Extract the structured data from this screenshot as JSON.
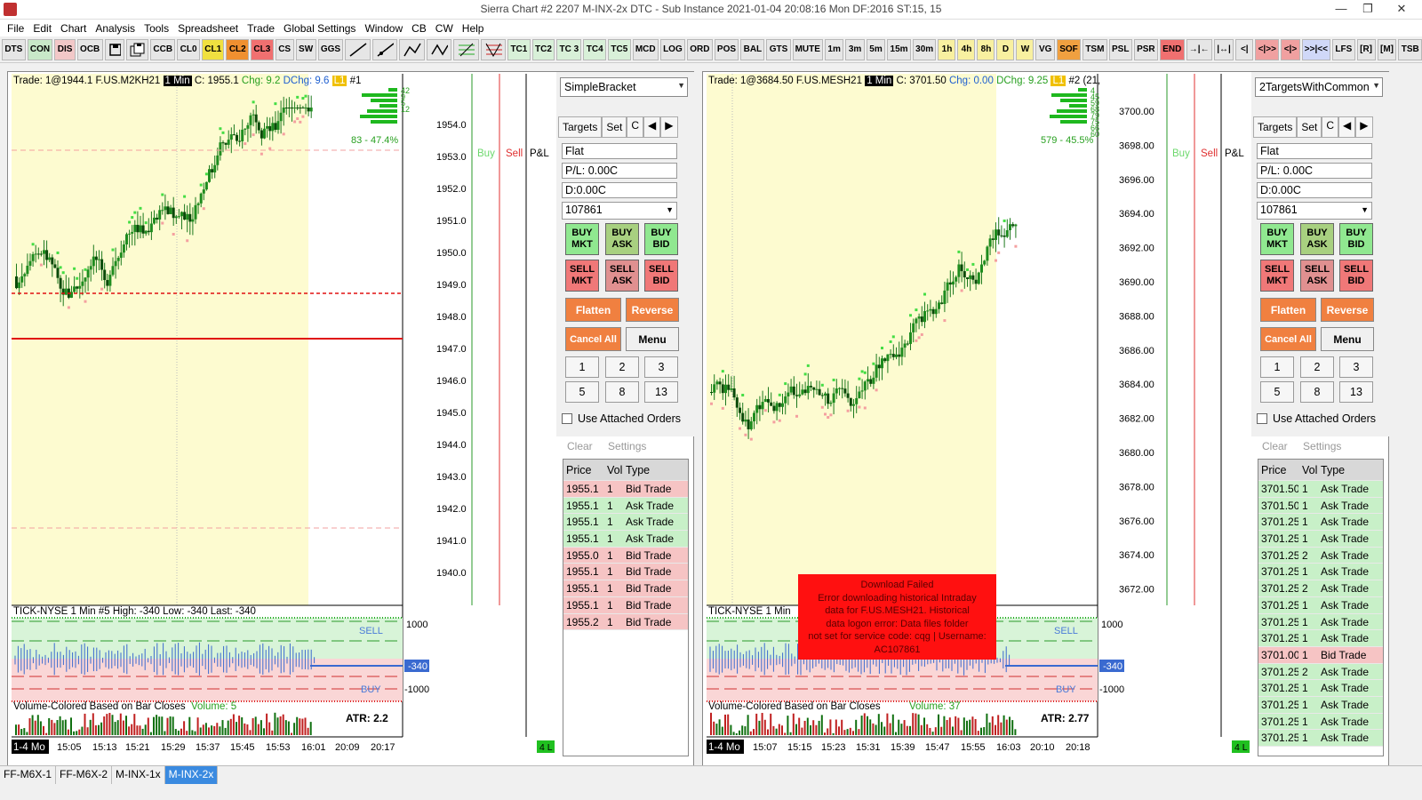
{
  "window": {
    "title": "Sierra Chart #2 2207 M-INX-2x  DTC - Sub Instance 2021-01-04  20:08:16 Mon  DF:2016  ST:15, 15"
  },
  "menu": [
    "File",
    "Edit",
    "Chart",
    "Analysis",
    "Tools",
    "Spreadsheet",
    "Trade",
    "Global Settings",
    "Window",
    "CB",
    "CW",
    "Help"
  ],
  "toolbar": [
    {
      "label": "DTS",
      "bg": "#e6e6e6"
    },
    {
      "label": "CON",
      "bg": "#c8e8c8"
    },
    {
      "label": "DIS",
      "bg": "#f2c8c8"
    },
    {
      "label": "OCB",
      "bg": "#e6e6e6"
    },
    {
      "label": "save-icon",
      "icon": true
    },
    {
      "label": "save-all-icon",
      "icon": true
    },
    {
      "label": "CCB",
      "bg": "#e6e6e6"
    },
    {
      "label": "CL0",
      "bg": "#e6e6e6"
    },
    {
      "label": "CL1",
      "bg": "#f0e040"
    },
    {
      "label": "CL2",
      "bg": "#f09030"
    },
    {
      "label": "CL3",
      "bg": "#f07070"
    },
    {
      "label": "CS",
      "bg": "#e6e6e6"
    },
    {
      "label": "SW",
      "bg": "#e6e6e6"
    },
    {
      "label": "GGS",
      "bg": "#e6e6e6"
    },
    {
      "label": "line-tool-icon",
      "icon": true
    },
    {
      "label": "ray-tool-icon",
      "icon": true
    },
    {
      "label": "multi-line-icon",
      "icon": true
    },
    {
      "label": "zigzag-icon",
      "icon": true
    },
    {
      "label": "fib-tool-icon",
      "icon": true
    },
    {
      "label": "fib-retrace-icon",
      "icon": true
    },
    {
      "label": "TC1",
      "bg": "#d8f0d8"
    },
    {
      "label": "TC2",
      "bg": "#d8f0d8"
    },
    {
      "label": "TC 3",
      "bg": "#d8f0d8"
    },
    {
      "label": "TC4",
      "bg": "#d8f0d8"
    },
    {
      "label": "TC5",
      "bg": "#d8f0d8"
    },
    {
      "label": "MCD",
      "bg": "#e6e6e6"
    },
    {
      "label": "LOG",
      "bg": "#e6e6e6"
    },
    {
      "label": "ORD",
      "bg": "#e6e6e6"
    },
    {
      "label": "POS",
      "bg": "#e6e6e6"
    },
    {
      "label": "BAL",
      "bg": "#e6e6e6"
    },
    {
      "label": "GTS",
      "bg": "#e6e6e6"
    },
    {
      "label": "MUTE",
      "bg": "#e6e6e6"
    },
    {
      "label": "1m",
      "bg": "#e6e6e6"
    },
    {
      "label": "3m",
      "bg": "#e6e6e6"
    },
    {
      "label": "5m",
      "bg": "#e6e6e6"
    },
    {
      "label": "15m",
      "bg": "#e6e6e6"
    },
    {
      "label": "30m",
      "bg": "#e6e6e6"
    },
    {
      "label": "1h",
      "bg": "#f8f0a0"
    },
    {
      "label": "4h",
      "bg": "#f8f0a0"
    },
    {
      "label": "8h",
      "bg": "#f8f0a0"
    },
    {
      "label": "D",
      "bg": "#f8f0a0"
    },
    {
      "label": "W",
      "bg": "#f8f0a0"
    },
    {
      "label": "VG",
      "bg": "#e6e6e6"
    },
    {
      "label": "SOF",
      "bg": "#f0a040"
    },
    {
      "label": "TSM",
      "bg": "#e6e6e6"
    },
    {
      "label": "PSL",
      "bg": "#e6e6e6"
    },
    {
      "label": "PSR",
      "bg": "#e6e6e6"
    },
    {
      "label": "END",
      "bg": "#f07070"
    },
    {
      "label": "→|←",
      "bg": "#e6e6e6"
    },
    {
      "label": "|↔|",
      "bg": "#e6e6e6"
    },
    {
      "label": "<|",
      "bg": "#e6e6e6"
    },
    {
      "label": "<|>>",
      "bg": "#f0a0a0"
    },
    {
      "label": "<|>",
      "bg": "#f0a0a0"
    },
    {
      "label": ">>|<<",
      "bg": "#d0d8f8"
    },
    {
      "label": "LFS",
      "bg": "#e6e6e6"
    },
    {
      "label": "[R]",
      "bg": "#e6e6e6"
    },
    {
      "label": "[M]",
      "bg": "#e6e6e6"
    },
    {
      "label": "TSB",
      "bg": "#e6e6e6"
    }
  ],
  "left_chart": {
    "info": {
      "trade": "Trade: 1@1944.1  F.US.M2KH21",
      "tf": "1 Min",
      "close": "C: 1955.1",
      "chg": "Chg: 9.2",
      "dchg": "DChg: 9.6",
      "l1": "L1",
      "num": "#1"
    },
    "profile_pct": "83 - 47.4%",
    "price_labels": [
      "1954.0",
      "1953.0",
      "1952.0",
      "1951.0",
      "1950.0",
      "1949.0",
      "1948.0",
      "1947.0",
      "1946.0",
      "1945.0",
      "1944.0",
      "1943.0",
      "1942.0",
      "1941.0",
      "1940.0"
    ],
    "profile_nums": [
      "42",
      "9",
      "5",
      "12"
    ],
    "tick_label": "TICK-NYSE  1 Min  #5  High: -340  Low: -340  Last: -340",
    "tick_sell": "SELL",
    "tick_buy": "BUY",
    "tick_axis": [
      "1000",
      "-340",
      "-1000"
    ],
    "vol_label": "Volume-Colored Based on Bar Closes",
    "vol_val": "Volume: 5",
    "atr": "ATR: 2.2",
    "time_labels": [
      "15:05",
      "15:13",
      "15:21",
      "15:29",
      "15:37",
      "15:45",
      "15:53",
      "16:01",
      "20:09",
      "20:17"
    ],
    "date_badge": "1-4 Mo",
    "hl": "4 L"
  },
  "right_chart": {
    "info": {
      "trade": "Trade: 1@3684.50  F.US.MESH21",
      "tf": "1 Min",
      "close": "C: 3701.50",
      "chg": "Chg: 0.00",
      "dchg": "DChg: 9.25",
      "l1": "L1",
      "num": "#2  (21,"
    },
    "profile_pct": "579 - 45.5%",
    "price_labels": [
      "3700.00",
      "3698.00",
      "3696.00",
      "3694.00",
      "3692.00",
      "3690.00",
      "3688.00",
      "3686.00",
      "3684.00",
      "3682.00",
      "3680.00",
      "3678.00",
      "3676.00",
      "3674.00",
      "3672.00"
    ],
    "profile_nums": [
      "4",
      "45",
      "59",
      "68",
      "79",
      "75",
      "66",
      "60"
    ],
    "tick_label": "TICK-NYSE  1 Min",
    "tick_sell": "SELL",
    "tick_buy": "BUY",
    "tick_axis": [
      "1000",
      "-340",
      "-1000"
    ],
    "vol_label": "Volume-Colored Based on Bar Closes",
    "vol_val": "Volume: 37",
    "atr": "ATR: 2.77",
    "time_labels": [
      "15:07",
      "15:15",
      "15:23",
      "15:31",
      "15:39",
      "15:47",
      "15:55",
      "16:03",
      "20:10",
      "20:18"
    ],
    "date_badge": "1-4 Mo",
    "hl": "4 L"
  },
  "buy_label": "Buy",
  "sell_label": "Sell",
  "pl_label": "P&L",
  "left_panel": {
    "strategy": "SimpleBracket",
    "status": "Flat",
    "pl": "P/L: 0.00C",
    "d": "D:0.00C",
    "qty": "107861"
  },
  "right_panel": {
    "strategy": "2TargetsWithCommon",
    "status": "Flat",
    "pl": "P/L: 0.00C",
    "d": "D:0.00C",
    "qty": "107861"
  },
  "panel_common": {
    "tab_targets": "Targets",
    "tab_set": "Set",
    "tab_c": "C",
    "left_arrow": "◀",
    "right_arrow": "▶",
    "buy_mkt": "BUY MKT",
    "buy_ask": "BUY ASK",
    "buy_bid": "BUY BID",
    "sell_mkt": "SELL MKT",
    "sell_ask": "SELL ASK",
    "sell_bid": "SELL BID",
    "flatten": "Flatten",
    "reverse": "Reverse",
    "cancel_all": "Cancel All",
    "menu": "Menu",
    "nums": [
      "1",
      "2",
      "3",
      "5",
      "8",
      "13"
    ],
    "use_attached": "Use Attached Orders"
  },
  "ts_common": {
    "clear": "Clear",
    "settings": "Settings",
    "col_price": "Price",
    "col_vol": "Vol",
    "col_type": "Type"
  },
  "left_ts": [
    {
      "price": "1955.1",
      "vol": "1",
      "type": "Bid Trade",
      "side": "bid"
    },
    {
      "price": "1955.1",
      "vol": "1",
      "type": "Ask Trade",
      "side": "ask"
    },
    {
      "price": "1955.1",
      "vol": "1",
      "type": "Ask Trade",
      "side": "ask"
    },
    {
      "price": "1955.1",
      "vol": "1",
      "type": "Ask Trade",
      "side": "ask"
    },
    {
      "price": "1955.0",
      "vol": "1",
      "type": "Bid Trade",
      "side": "bid"
    },
    {
      "price": "1955.1",
      "vol": "1",
      "type": "Bid Trade",
      "side": "bid"
    },
    {
      "price": "1955.1",
      "vol": "1",
      "type": "Bid Trade",
      "side": "bid"
    },
    {
      "price": "1955.1",
      "vol": "1",
      "type": "Bid Trade",
      "side": "bid"
    },
    {
      "price": "1955.2",
      "vol": "1",
      "type": "Bid Trade",
      "side": "bid"
    }
  ],
  "right_ts": [
    {
      "price": "3701.50",
      "vol": "1",
      "type": "Ask Trade",
      "side": "ask"
    },
    {
      "price": "3701.50",
      "vol": "1",
      "type": "Ask Trade",
      "side": "ask"
    },
    {
      "price": "3701.25",
      "vol": "1",
      "type": "Ask Trade",
      "side": "ask"
    },
    {
      "price": "3701.25",
      "vol": "1",
      "type": "Ask Trade",
      "side": "ask"
    },
    {
      "price": "3701.25",
      "vol": "2",
      "type": "Ask Trade",
      "side": "ask"
    },
    {
      "price": "3701.25",
      "vol": "1",
      "type": "Ask Trade",
      "side": "ask"
    },
    {
      "price": "3701.25",
      "vol": "2",
      "type": "Ask Trade",
      "side": "ask"
    },
    {
      "price": "3701.25",
      "vol": "1",
      "type": "Ask Trade",
      "side": "ask"
    },
    {
      "price": "3701.25",
      "vol": "1",
      "type": "Ask Trade",
      "side": "ask"
    },
    {
      "price": "3701.25",
      "vol": "1",
      "type": "Ask Trade",
      "side": "ask"
    },
    {
      "price": "3701.00",
      "vol": "1",
      "type": "Bid Trade",
      "side": "bid"
    },
    {
      "price": "3701.25",
      "vol": "2",
      "type": "Ask Trade",
      "side": "ask"
    },
    {
      "price": "3701.25",
      "vol": "1",
      "type": "Ask Trade",
      "side": "ask"
    },
    {
      "price": "3701.25",
      "vol": "1",
      "type": "Ask Trade",
      "side": "ask"
    },
    {
      "price": "3701.25",
      "vol": "1",
      "type": "Ask Trade",
      "side": "ask"
    },
    {
      "price": "3701.25",
      "vol": "1",
      "type": "Ask Trade",
      "side": "ask"
    }
  ],
  "error": {
    "title": "Download Failed",
    "lines": [
      "Error downloading historical Intraday",
      "data for F.US.MESH21.  Historical",
      "data logon error: Data files folder",
      "not set for service code: cqg | Username:",
      "AC107861"
    ]
  },
  "bottom_tabs": [
    "FF-M6X-1",
    "FF-M6X-2",
    "M-INX-1x",
    "M-INX-2x"
  ],
  "active_tab": "M-INX-2x"
}
